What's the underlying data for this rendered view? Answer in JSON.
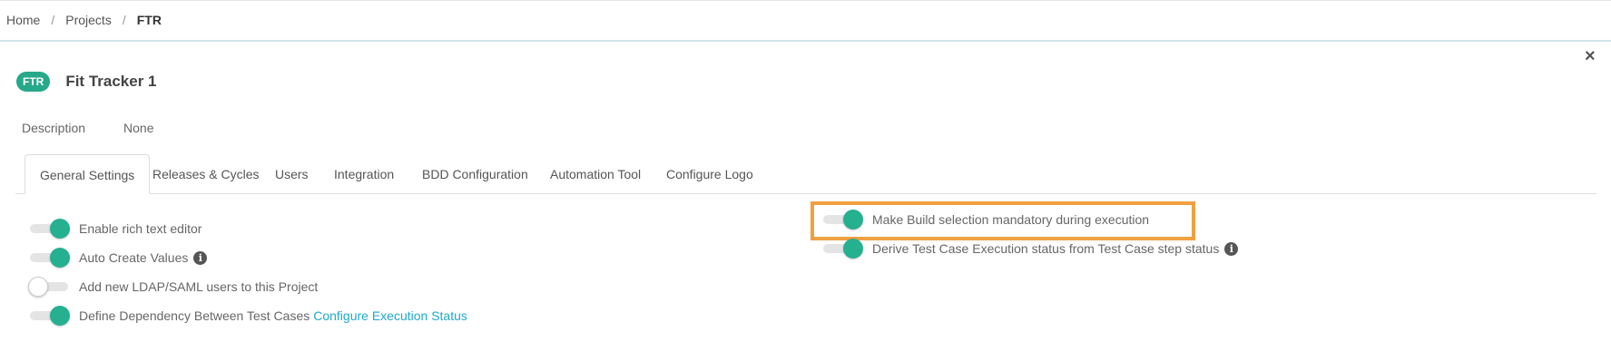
{
  "breadcrumb": {
    "home": "Home",
    "projects": "Projects",
    "current": "FTR",
    "separator": "/"
  },
  "close_icon": "×",
  "project": {
    "badge": "FTR",
    "name": "Fit Tracker 1"
  },
  "description": {
    "label": "Description",
    "value": "None"
  },
  "tabs": [
    {
      "label": "General Settings",
      "active": true
    },
    {
      "label": "Releases & Cycles"
    },
    {
      "label": "Users"
    },
    {
      "label": "Integration"
    },
    {
      "label": "BDD Configuration"
    },
    {
      "label": "Automation Tool"
    },
    {
      "label": "Configure Logo"
    }
  ],
  "settings_left": [
    {
      "label": "Enable rich text editor",
      "on": true
    },
    {
      "label": "Auto Create Values",
      "on": true,
      "info": "i"
    },
    {
      "label": "Add new LDAP/SAML users to this Project",
      "on": false
    },
    {
      "label": "Define Dependency Between Test Cases",
      "on": true,
      "link": "Configure Execution Status"
    }
  ],
  "settings_right": [
    {
      "label": "Make Build selection mandatory during execution",
      "on": true,
      "highlighted": true
    },
    {
      "label": "Derive Test Case Execution status from Test Case step status",
      "on": true,
      "info": "i"
    }
  ],
  "colors": {
    "accent": "#25b090",
    "highlight": "#f0a040",
    "link": "#1eaacb",
    "badge": "#25a98a"
  }
}
